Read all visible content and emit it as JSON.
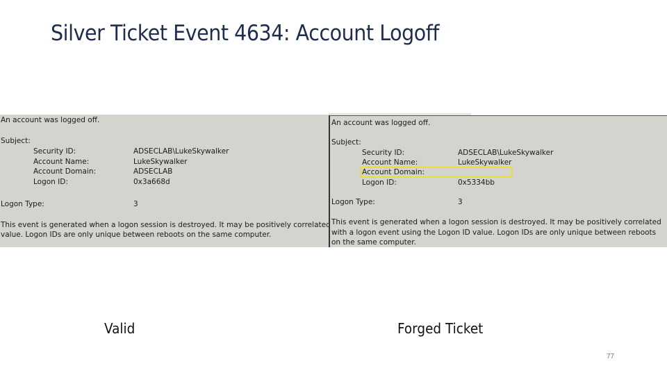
{
  "slide": {
    "title": "Silver Ticket Event 4634: Account Logoff",
    "page_number": "77",
    "highlight_color": "#e8df3a"
  },
  "valid": {
    "caption": "Valid",
    "event": {
      "heading": "An account was logged off.",
      "subject_label": "Subject:",
      "fields": [
        {
          "label": "Security ID:",
          "value": "ADSECLAB\\LukeSkywalker"
        },
        {
          "label": "Account Name:",
          "value": "LukeSkywalker"
        },
        {
          "label": "Account Domain:",
          "value": "ADSECLAB"
        },
        {
          "label": "Logon ID:",
          "value": "0x3a668d"
        }
      ],
      "logon_type_label": "Logon Type:",
      "logon_type_value": "3",
      "description_line1": "This event is generated when a logon session is destroyed. It may be positively correlated w",
      "description_line2": "value. Logon IDs are only unique between reboots on the same computer."
    }
  },
  "forged": {
    "caption": "Forged Ticket",
    "event": {
      "heading": "An account was logged off.",
      "subject_label": "Subject:",
      "fields": [
        {
          "label": "Security ID:",
          "value": "ADSECLAB\\LukeSkywalker"
        },
        {
          "label": "Account Name:",
          "value": "LukeSkywalker"
        },
        {
          "label": "Account Domain:",
          "value": ""
        },
        {
          "label": "Logon ID:",
          "value": "0x5334bb"
        }
      ],
      "logon_type_label": "Logon Type:",
      "logon_type_value": "3",
      "description": "This event is generated when a logon session is destroyed. It may be positively correlated with a logon event using the Logon ID value. Logon IDs are only unique between reboots on the same computer."
    }
  }
}
